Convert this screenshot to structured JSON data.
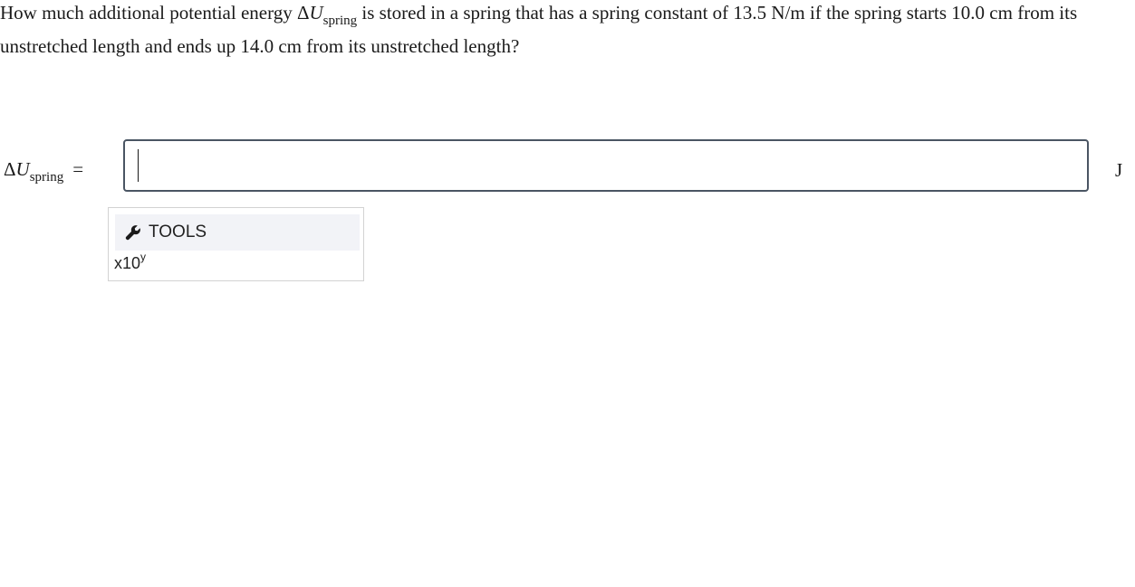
{
  "question": {
    "part1": "How much additional potential energy ",
    "delta": "Δ",
    "var": "U",
    "sub": "spring",
    "part2": " is stored in a spring that has a spring constant of 13.5 N/m if the spring starts 10.0 cm from its unstretched length and ends up 14.0 cm from its unstretched length?"
  },
  "answer": {
    "delta": "Δ",
    "var": "U",
    "sub": "spring",
    "equals": "=",
    "value": "",
    "unit": "J"
  },
  "tools": {
    "header_label": "TOOLS",
    "sci_base": "x10",
    "sci_exp": "y"
  },
  "icons": {
    "tools_icon": "wrench-icon"
  }
}
